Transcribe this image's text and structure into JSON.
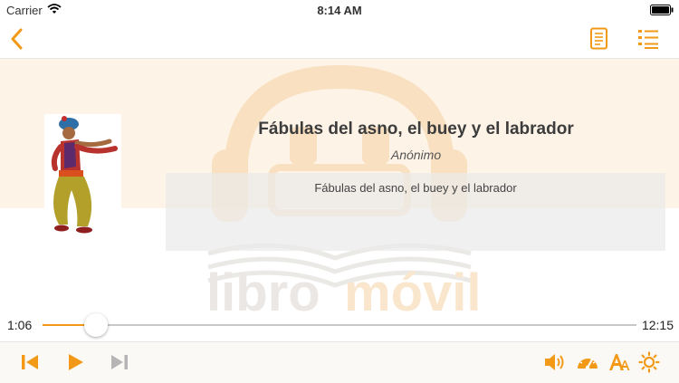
{
  "status_bar": {
    "carrier": "Carrier",
    "time": "8:14 AM"
  },
  "nav": {
    "back_icon": "chevron-left-icon",
    "document_icon": "document-icon",
    "chapters_icon": "list-icon"
  },
  "book": {
    "title": "Fábulas del asno, el buey y el labrador",
    "author": "Anónimo",
    "description": "Fábulas del asno, el buey y el labrador",
    "cover": "cover-illustration-dancing-man"
  },
  "watermark": {
    "text_a": "libro",
    "text_b": "móvil"
  },
  "player": {
    "elapsed": "1:06",
    "duration": "12:15",
    "progress": 0.09
  },
  "toolbar": {
    "icons": [
      "skip-back-icon",
      "play-icon",
      "skip-forward-icon",
      "volume-icon",
      "speed-gauge-icon",
      "font-size-icon",
      "brightness-icon"
    ]
  },
  "colors": {
    "accent": "#f29a17",
    "disabled": "#b5b5b5",
    "band": "#fdf3e7"
  }
}
